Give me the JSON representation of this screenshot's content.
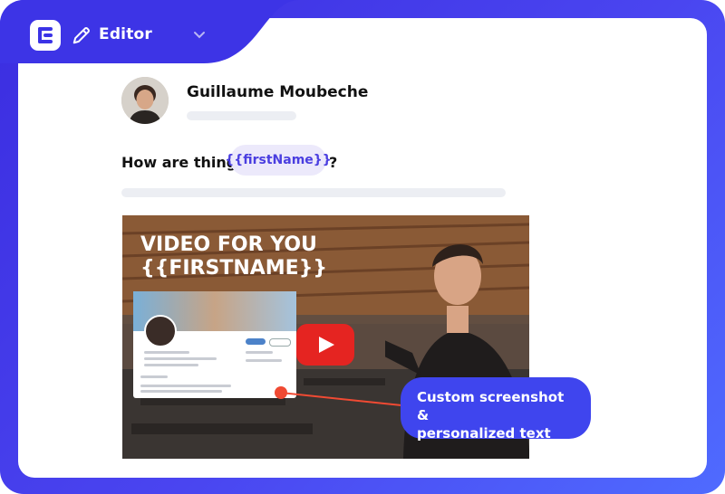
{
  "header": {
    "editor_label": "Editor",
    "logo_icon": "app-logo-icon",
    "pencil_icon": "pencil-icon",
    "dropdown_icon": "chevron-down-icon"
  },
  "profile": {
    "name": "Guillaume Moubeche"
  },
  "message": {
    "text": "How are things",
    "variable": "{{firstName}}",
    "suffix": "?"
  },
  "video": {
    "title_line1": "VIDEO FOR YOU",
    "title_line2": "{{FIRSTNAME}}",
    "play_icon": "play-icon"
  },
  "callout": {
    "line1": "Custom screenshot &",
    "line2": "personalized text"
  },
  "colors": {
    "brand": "#3b2de0",
    "accent": "#4a3ee0",
    "token_bg": "#ece9fb",
    "pointer": "#f04a33",
    "youtube_red": "#e52421"
  }
}
